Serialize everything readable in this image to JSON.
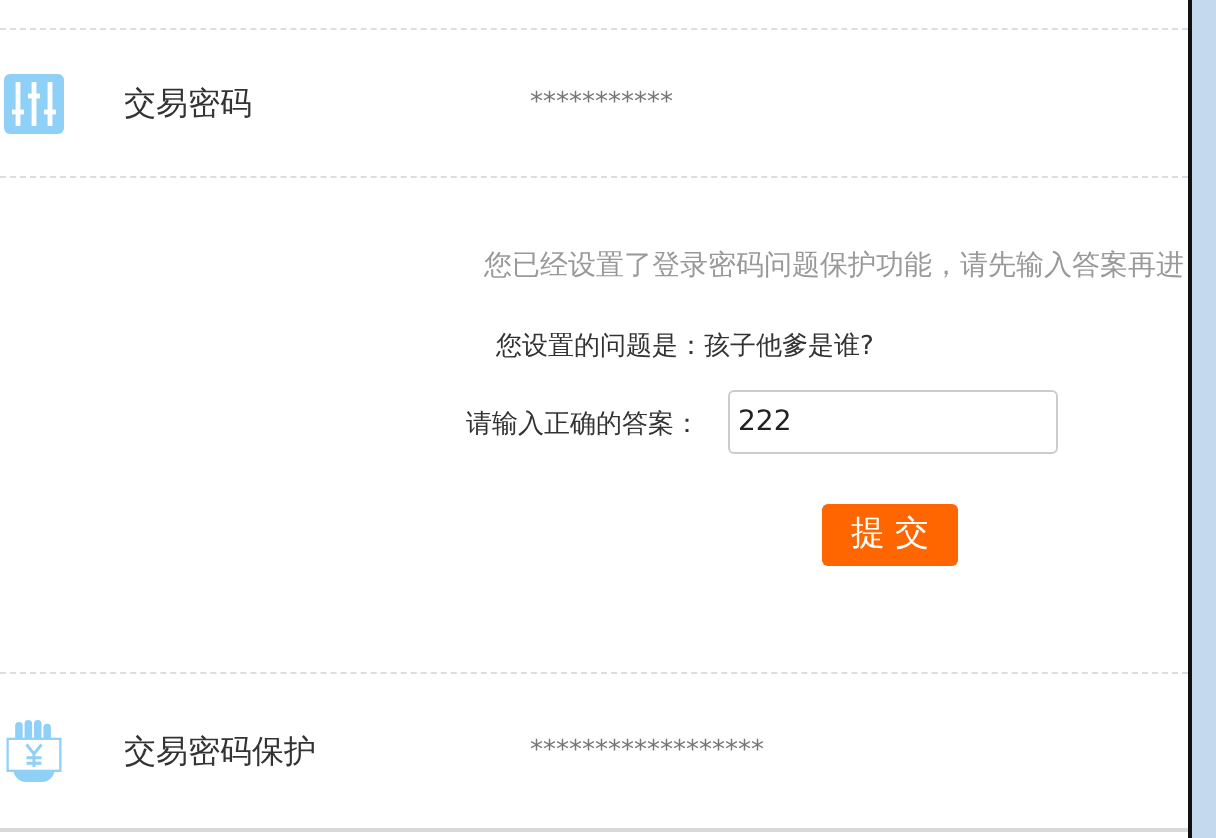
{
  "settings": [
    {
      "kind": "sliders",
      "label": "交易密码",
      "value": "***********"
    },
    {
      "kind": "hand",
      "label": "交易密码保护",
      "value": "******************"
    }
  ],
  "form": {
    "notice": "您已经设置了登录密码问题保护功能，请先输入答案再进",
    "question": "您设置的问题是：孩子他爹是谁?",
    "answer_label": "请输入正确的答案：",
    "answer_value": "222",
    "submit": "提 交"
  }
}
